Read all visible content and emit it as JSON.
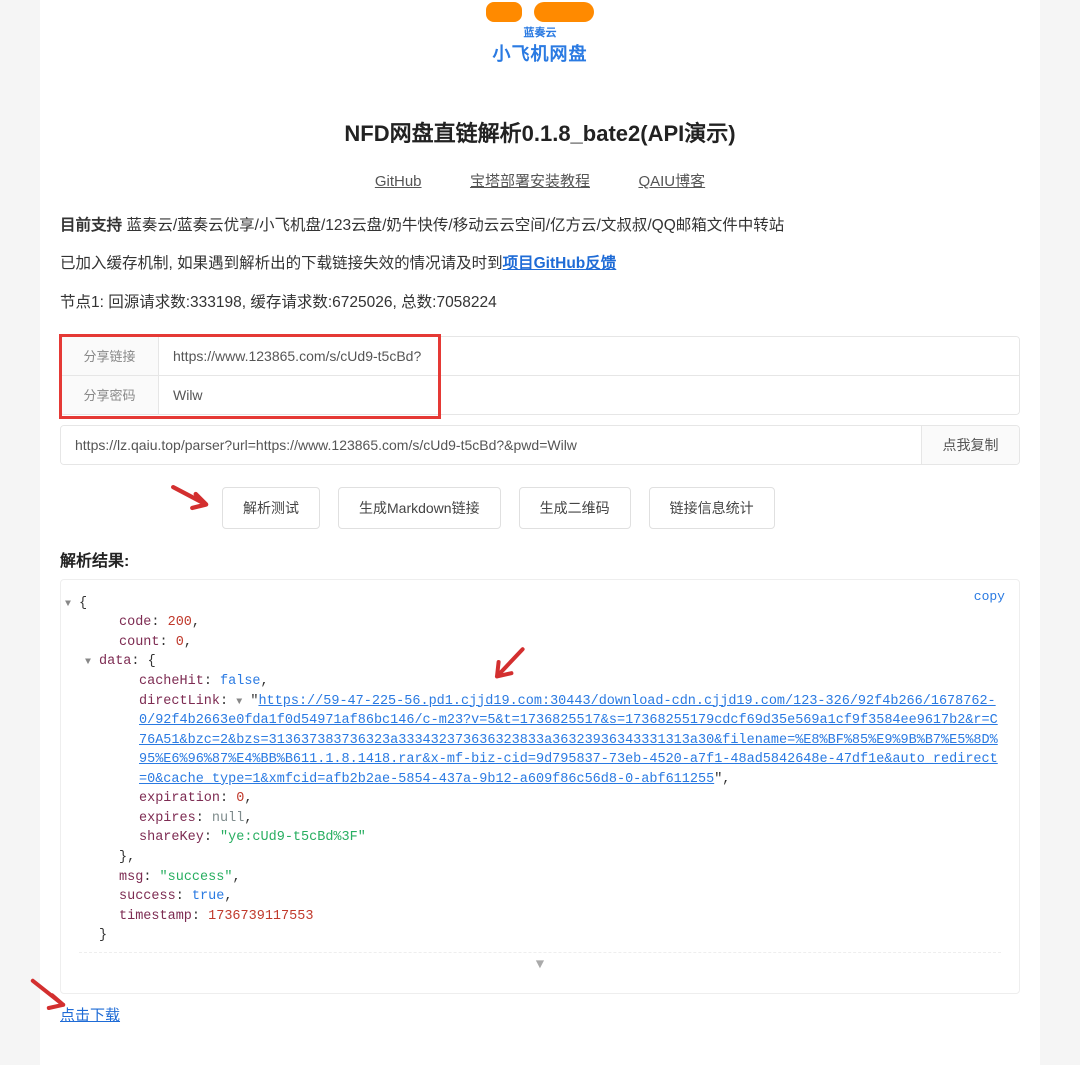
{
  "logo": {
    "small_text": "蓝奏云",
    "main_text": "小飞机网盘"
  },
  "title": "NFD网盘直链解析0.1.8_bate2(API演示)",
  "nav": {
    "github": "GitHub",
    "bt_tutorial": "宝塔部署安装教程",
    "qaiu_blog": "QAIU博客"
  },
  "support": {
    "label": "目前支持",
    "list": "蓝奏云/蓝奏云优享/小飞机盘/123云盘/奶牛快传/移动云云空间/亿方云/文叔叔/QQ邮箱文件中转站"
  },
  "cache_note": {
    "prefix": "已加入缓存机制, 如果遇到解析出的下载链接失效的情况请及时到",
    "link_text": "项目GitHub反馈"
  },
  "stats": "节点1: 回源请求数:333198, 缓存请求数:6725026, 总数:7058224",
  "form": {
    "share_link_label": "分享链接",
    "share_link_value": "https://www.123865.com/s/cUd9-t5cBd?",
    "share_pwd_label": "分享密码",
    "share_pwd_value": "Wilw",
    "parsed_url": "https://lz.qaiu.top/parser?url=https://www.123865.com/s/cUd9-t5cBd?&pwd=Wilw",
    "copy_btn": "点我复制"
  },
  "buttons": {
    "parse_test": "解析测试",
    "gen_markdown": "生成Markdown链接",
    "gen_qr": "生成二维码",
    "link_stats": "链接信息统计"
  },
  "result_label": "解析结果:",
  "json": {
    "copy": "copy",
    "code": "200",
    "count": "0",
    "cacheHit": "false",
    "directLink": "https://59-47-225-56.pd1.cjjd19.com:30443/download-cdn.cjjd19.com/123-326/92f4b266/1678762-0/92f4b2663e0fda1f0d54971af86bc146/c-m23?v=5&t=1736825517&s=17368255179cdcf69d35e569a1cf9f3584ee9617b2&r=C76A51&bzc=2&bzs=313637383736323a333432373636323833a36323936343331313a30&filename=%E8%BF%85%E9%9B%B7%E5%8D%95%E6%96%87%E4%BB%B611.1.8.1418.rar&x-mf-biz-cid=9d795837-73eb-4520-a7f1-48ad5842648e-47df1e&auto_redirect=0&cache_type=1&xmfcid=afb2b2ae-5854-437a-9b12-a609f86c56d8-0-abf611255",
    "expiration": "0",
    "expires": "null",
    "shareKey": "\"ye:cUd9-t5cBd%3F\"",
    "msg": "\"success\"",
    "success": "true",
    "timestamp": "1736739117553"
  },
  "download_text": "点击下载",
  "collapse_glyph": "▼"
}
